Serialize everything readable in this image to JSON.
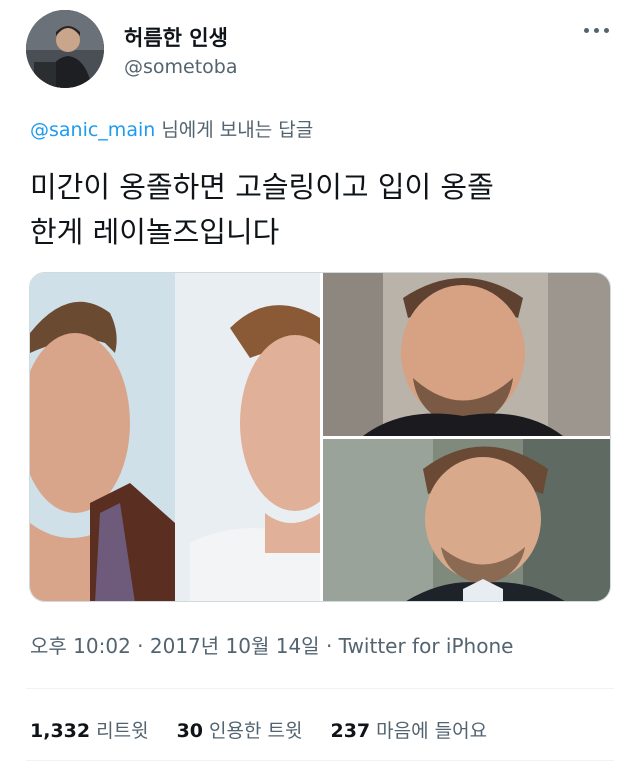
{
  "user": {
    "display_name": "허름한 인생",
    "handle": "@sometoba",
    "avatar_icon": "user-avatar-photo"
  },
  "reply": {
    "mention": "@sanic_main",
    "suffix": " 님에게 보내는 답글"
  },
  "tweet": {
    "line1": "미간이 옹졸하면 고슬링이고 입이 옹졸",
    "line2": "한게 레이놀즈입니다"
  },
  "media": {
    "photos": [
      "side-by-side-faces-photo",
      "smiling-man-portrait-photo",
      "man-in-suit-portrait-photo"
    ]
  },
  "meta": {
    "time": "오후 10:02",
    "sep1": " · ",
    "date": "2017년 10월 14일",
    "sep2": " · ",
    "source": "Twitter for iPhone"
  },
  "stats": {
    "retweets_count": "1,332",
    "retweets_label": "리트윗",
    "quotes_count": "30",
    "quotes_label": "인용한 트윗",
    "likes_count": "237",
    "likes_label": "마음에 들어요"
  },
  "colors": {
    "link": "#1d9bf0",
    "secondary_text": "#536471",
    "primary_text": "#0f1419"
  }
}
